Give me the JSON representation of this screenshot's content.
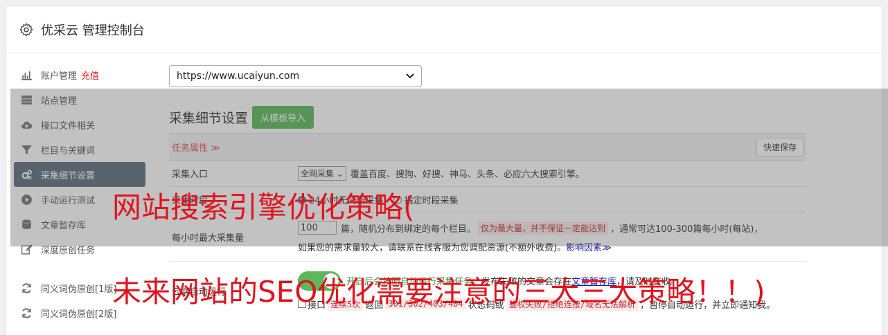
{
  "header": {
    "title": "优采云 管理控制台",
    "icon": "gear-icon"
  },
  "sidebar": {
    "items": [
      {
        "label": "账户管理",
        "extra": "充值",
        "icon": "bar-chart-icon"
      },
      {
        "label": "站点管理",
        "icon": "server-icon"
      },
      {
        "label": "接口文件相关",
        "icon": "cloud-upload-icon"
      },
      {
        "label": "栏目与关键词",
        "icon": "filter-icon"
      },
      {
        "label": "采集细节设置",
        "icon": "gears-icon",
        "active": true
      },
      {
        "label": "手动运行测试",
        "icon": "play-circle-icon"
      },
      {
        "label": "文章暂存库",
        "icon": "database-icon"
      },
      {
        "label": "深度原创任务",
        "icon": "edit-icon"
      },
      {
        "label": "同义词伪原创[1版]",
        "icon": "refresh-icon"
      },
      {
        "label": "同义词伪原创[2版]",
        "icon": "refresh-icon"
      }
    ]
  },
  "main": {
    "site_select": "https://www.ucaiyun.com",
    "section_title": "采集细节设置",
    "import_button": "从模板导入",
    "task_label": "任务属性 ≫",
    "save_button": "快速保存",
    "rows": {
      "entry": {
        "label": "采集入口",
        "select": "全网采集",
        "text": "覆盖百度、搜狗、好搜、神马、头条、必应六大搜索引擎。"
      },
      "time": {
        "label": "采集时段",
        "text": "24小时无间断采集",
        "text2": "指定时段采集"
      },
      "max": {
        "label": "每小时最大采集量",
        "input": "100",
        "text1": "篇，随机分布到绑定的每个栏目。",
        "badge": "仅为最大量，并不保证一定能达到",
        "text2": "，通常可达100-300篇每小时(每站)，",
        "text3": "如果您的需求量较大，请联系在线客服为您调配资源(不额外收费)。",
        "link": "影响因素≫"
      },
      "auto": {
        "label": "云端自动运行",
        "text1": "开启后会按照自动运行采集任务，",
        "text2": "发布失败的文章会存在",
        "link": "文章暂存库",
        "text3": "，请及时查收。",
        "chk_label": "接口",
        "badge1": "连续5次",
        "text4": "返回",
        "badge2": "301/302/403/404",
        "text5": "状态码或",
        "badge3": "鉴权失败/拒绝连接/域名无法解析",
        "text6": "，暂停自动运行，并立即通知我。"
      }
    }
  },
  "overlay": {
    "line1": "网站搜索引擎优化策略(",
    "line2": "未来网站的SEO优化需要注意的三大三大策略！！)"
  },
  "colors": {
    "active_bg": "#5d6d7e",
    "green": "#5cb85c",
    "overlay_red": "#e0141e",
    "recharge_red": "#e02020"
  }
}
